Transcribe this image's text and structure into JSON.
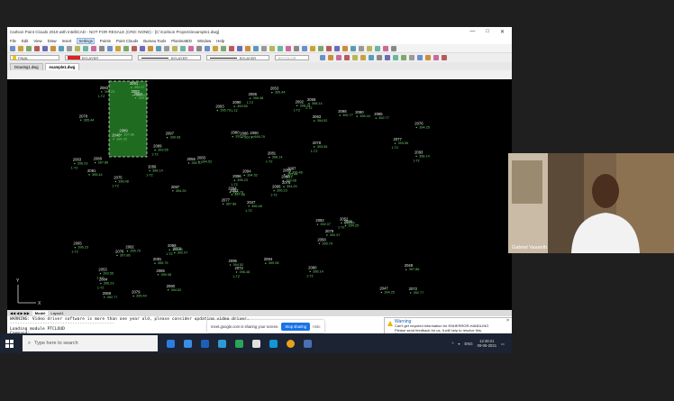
{
  "app": {
    "title": "Carlson Point Clouds 2019 with IntelliCAD - NOT FOR RESALE (CRD: NONE) - [C:\\Carlson Projects\\example1.dwg]",
    "window_controls": [
      "—",
      "□",
      "✕"
    ]
  },
  "menu": [
    "File",
    "Edit",
    "View",
    "Draw",
    "Insert",
    "Settings",
    "Points",
    "Point Clouds",
    "Bureau Tools",
    "PlanimatED",
    "Window",
    "Help"
  ],
  "menu_active": "Settings",
  "properties": {
    "layer": "FINAL",
    "color": "BYLAYER",
    "linetype": "BYLAYER",
    "lineweight": "BYLAYER",
    "plotstyle": "BYCOLOR"
  },
  "doc_tabs": [
    "Drawing1.dwg",
    "example1.dwg"
  ],
  "doc_tab_active": "example1.dwg",
  "layout_tabs": [
    "Model",
    "Layout1"
  ],
  "command_lines": [
    "WARNING: Video driver software is more than one year old, please consider updating video driver.",
    "------------------------------------------",
    "Loading module PTCLOUD",
    "Command:",
    "Opposite corner:"
  ],
  "warning": {
    "title": "Warning",
    "line1": "Can't get required information for ENHERROR-HANDLING",
    "line2": "Please send feedback for us, it will help to resolve this.",
    "link": "Send feedback"
  },
  "share_bar": {
    "message": "meet.google.com is sharing your screen.",
    "stop": "Stop sharing",
    "hide": "Hide"
  },
  "taskbar": {
    "search_placeholder": "Type here to search",
    "language": "ENG",
    "time": "12:49:21",
    "date": "09-06-2021"
  },
  "participant": {
    "name": "Gabriel Vasanth"
  },
  "drawing": {
    "point_labels": [
      "2047",
      "2048",
      "2052",
      "2053",
      "2055",
      "2056",
      "2058",
      "2060",
      "2063",
      "2066",
      "2069",
      "2072",
      "2075",
      "2076",
      "2077",
      "2078",
      "2079",
      "2080",
      "2081",
      "2082",
      "2083",
      "2084",
      "2085",
      "2086",
      "2087",
      "2088",
      "2089",
      "2090",
      "2091",
      "2092",
      "2093",
      "2094",
      "2095",
      "2096",
      "2097",
      "2098",
      "2099"
    ],
    "elevations": [
      "396.48",
      "394.25",
      "397.86",
      "393.55",
      "395.44",
      "392.07",
      "398.14",
      "395.79",
      "394.52",
      "396.23",
      "399.08",
      "392.77"
    ],
    "code": "1-TZ",
    "axis_x": "X",
    "axis_y": "Y"
  },
  "colors": {
    "canvas": "#000000",
    "point_label": "#e8e8e8",
    "elevation": "#6fd36f",
    "selection_fill": "#1f6b1f",
    "selection_border": "#d8d8d8"
  }
}
